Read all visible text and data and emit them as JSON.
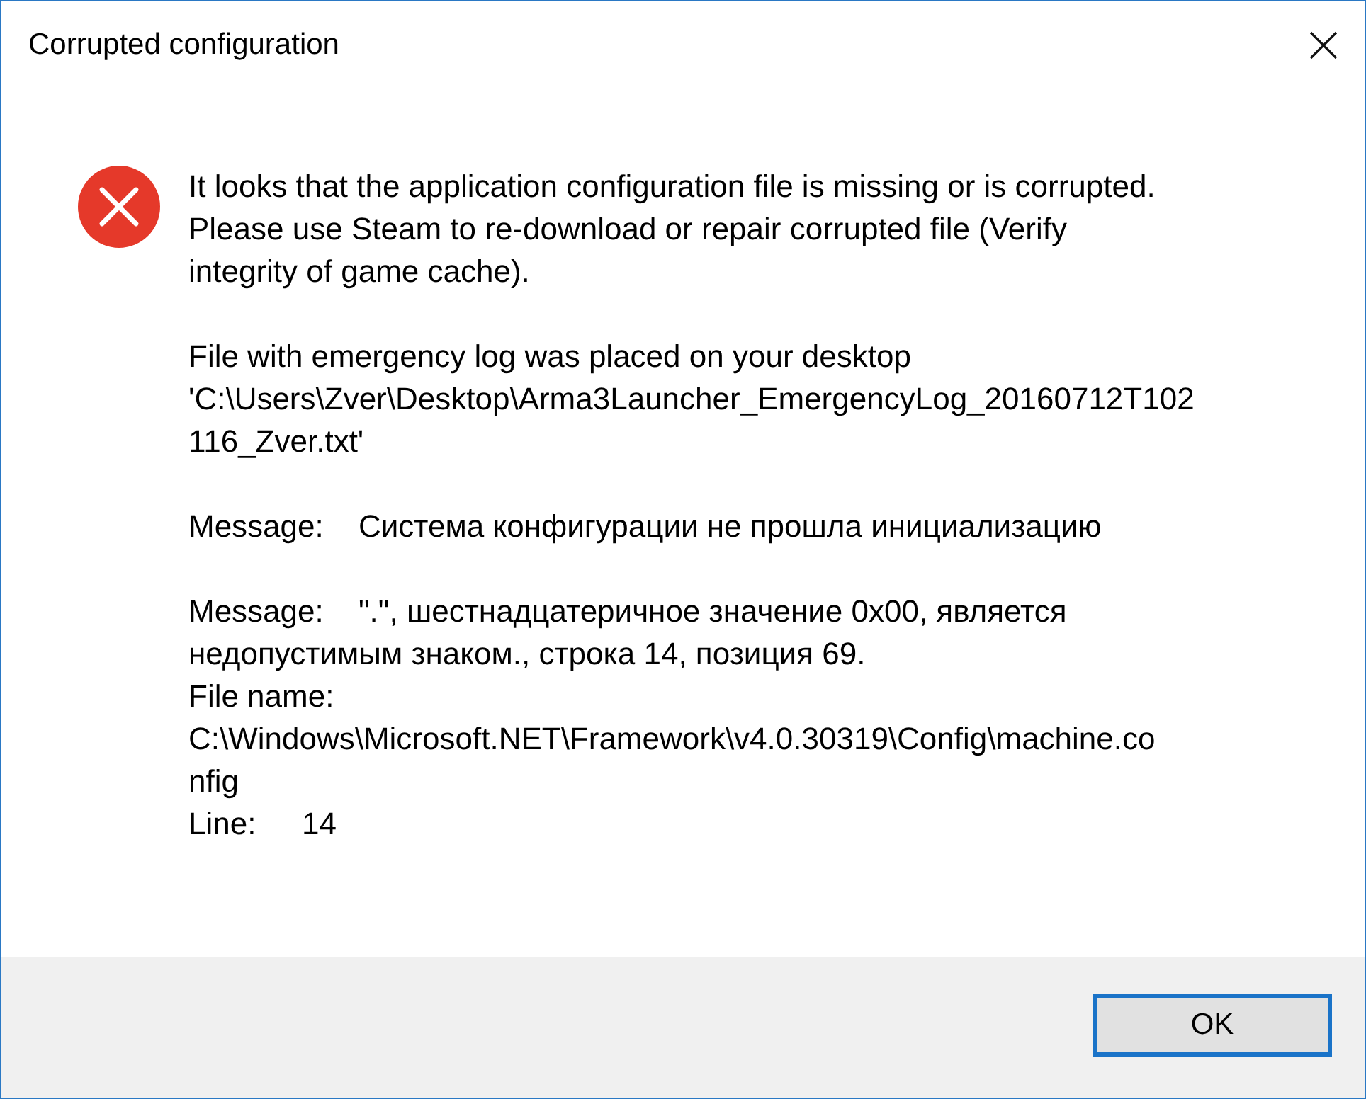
{
  "window": {
    "title": "Corrupted configuration"
  },
  "message": {
    "paragraphs": [
      "It looks that the application configuration file is missing or is corrupted.\nPlease use Steam to re-download or repair corrupted file (Verify\nintegrity of game cache).",
      "File with emergency log was placed on your desktop\n'C:\\Users\\Zver\\Desktop\\Arma3Launcher_EmergencyLog_20160712T102\n116_Zver.txt'",
      "Message:\tСистема конфигурации не прошла инициализацию",
      "Message:\t\".\", шестнадцатеричное значение 0x00, является\nнедопустимым знаком., строка 14, позиция 69.\nFile name:\nC:\\Windows\\Microsoft.NET\\Framework\\v4.0.30319\\Config\\machine.co\nnfig\nLine:\t14"
    ]
  },
  "buttons": [
    {
      "label": "OK",
      "focused": true
    }
  ]
}
